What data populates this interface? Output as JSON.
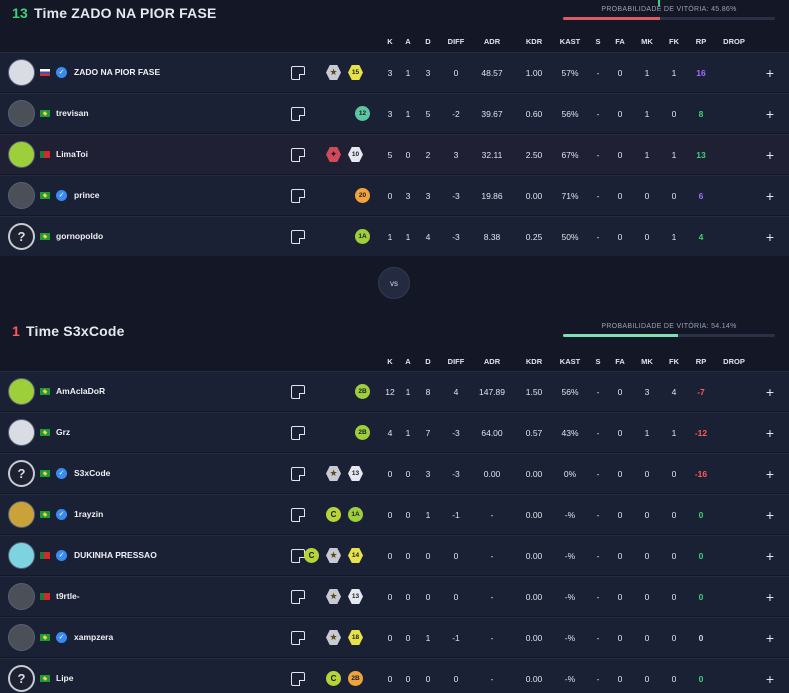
{
  "columns": [
    "K",
    "A",
    "D",
    "DIFF",
    "ADR",
    "KDR",
    "KAST",
    "S",
    "FA",
    "MK",
    "FK",
    "RP",
    "DROP"
  ],
  "vs_label": "vs",
  "teams": [
    {
      "score": "13",
      "score_color": "#3ad27a",
      "name": "Time ZADO NA PIOR FASE",
      "prob_label": "PROBABILIDADE DE VITÓRIA: 45.86%",
      "prob_fraction": 0.4586,
      "prob_color": "#e05a63",
      "players": [
        {
          "name": "ZADO NA PIOR FASE",
          "flag": "ru",
          "verified": true,
          "avatar": "white",
          "badges": [
            {
              "k": "star",
              "t": "★"
            },
            {
              "k": "level",
              "t": "15"
            }
          ],
          "stats": [
            "3",
            "1",
            "3",
            "0",
            "48.57",
            "1.00",
            "57%",
            "-",
            "0",
            "1",
            "1",
            "16"
          ],
          "rp_color": "purple"
        },
        {
          "name": "trevisan",
          "flag": "br",
          "verified": false,
          "avatar": "dark",
          "badges": [
            {
              "k": "circle-t",
              "t": "12"
            }
          ],
          "stats": [
            "3",
            "1",
            "5",
            "-2",
            "39.67",
            "0.60",
            "56%",
            "-",
            "0",
            "1",
            "0",
            "8"
          ],
          "rp_color": "green"
        },
        {
          "name": "LimaToi",
          "flag": "pt",
          "verified": false,
          "avatar": "lime",
          "badges": [
            {
              "k": "star red",
              "t": "✦"
            },
            {
              "k": "level w",
              "t": "10"
            }
          ],
          "stats": [
            "5",
            "0",
            "2",
            "3",
            "32.11",
            "2.50",
            "67%",
            "-",
            "0",
            "1",
            "1",
            "13"
          ],
          "rp_color": "green",
          "highlight": true
        },
        {
          "name": "prince",
          "flag": "br",
          "verified": true,
          "avatar": "dark",
          "badges": [
            {
              "k": "circle-o",
              "t": "20"
            }
          ],
          "stats": [
            "0",
            "3",
            "3",
            "-3",
            "19.86",
            "0.00",
            "71%",
            "-",
            "0",
            "0",
            "0",
            "6"
          ],
          "rp_color": "purple"
        },
        {
          "name": "gornopoldo",
          "flag": "br",
          "verified": false,
          "avatar": "q",
          "badges": [
            {
              "k": "circle-g",
              "t": "1A"
            }
          ],
          "stats": [
            "1",
            "1",
            "4",
            "-3",
            "8.38",
            "0.25",
            "50%",
            "-",
            "0",
            "0",
            "1",
            "4"
          ],
          "rp_color": "green"
        }
      ]
    },
    {
      "score": "1",
      "score_color": "#ff5a5a",
      "name": "Time S3xCode",
      "prob_label": "PROBABILIDADE DE VITÓRIA: 54.14%",
      "prob_fraction": 0.5414,
      "prob_color": "#7ee0b0",
      "players": [
        {
          "name": "AmAclaDoR",
          "flag": "br",
          "verified": false,
          "avatar": "lime",
          "badges": [
            {
              "k": "circle-g",
              "t": "2B"
            }
          ],
          "stats": [
            "12",
            "1",
            "8",
            "4",
            "147.89",
            "1.50",
            "56%",
            "-",
            "0",
            "3",
            "4",
            "-7"
          ],
          "rp_color": "red"
        },
        {
          "name": "Grz",
          "flag": "br",
          "verified": false,
          "avatar": "white",
          "badges": [
            {
              "k": "circle-g",
              "t": "2B"
            }
          ],
          "stats": [
            "4",
            "1",
            "7",
            "-3",
            "64.00",
            "0.57",
            "43%",
            "-",
            "0",
            "1",
            "1",
            "-12"
          ],
          "rp_color": "red"
        },
        {
          "name": "S3xCode",
          "flag": "br",
          "verified": true,
          "avatar": "q",
          "badges": [
            {
              "k": "star",
              "t": "★"
            },
            {
              "k": "level w",
              "t": "13"
            }
          ],
          "stats": [
            "0",
            "0",
            "3",
            "-3",
            "0.00",
            "0.00",
            "0%",
            "-",
            "0",
            "0",
            "0",
            "-16"
          ],
          "rp_color": "red"
        },
        {
          "name": "1rayzin",
          "flag": "br",
          "verified": true,
          "avatar": "gold",
          "badges": [
            {
              "k": "c",
              "t": "C"
            },
            {
              "k": "circle-g",
              "t": "1A"
            }
          ],
          "stats": [
            "0",
            "0",
            "1",
            "-1",
            "-",
            "0.00",
            "-%",
            "-",
            "0",
            "0",
            "0",
            "0"
          ],
          "rp_color": "green"
        },
        {
          "name": "DUKINHA PRESSAO",
          "flag": "pt",
          "verified": true,
          "avatar": "cyan",
          "badges": [
            {
              "k": "c",
              "t": "C"
            },
            {
              "k": "star",
              "t": "★"
            },
            {
              "k": "level",
              "t": "14"
            }
          ],
          "stats": [
            "0",
            "0",
            "0",
            "0",
            "-",
            "0.00",
            "-%",
            "-",
            "0",
            "0",
            "0",
            "0"
          ],
          "rp_color": "green"
        },
        {
          "name": "t9rtle-",
          "flag": "pt",
          "verified": false,
          "avatar": "dark",
          "badges": [
            {
              "k": "star",
              "t": "★"
            },
            {
              "k": "level w",
              "t": "13"
            }
          ],
          "stats": [
            "0",
            "0",
            "0",
            "0",
            "-",
            "0.00",
            "-%",
            "-",
            "0",
            "0",
            "0",
            "0"
          ],
          "rp_color": "green"
        },
        {
          "name": "xampzera",
          "flag": "br",
          "verified": true,
          "avatar": "dark",
          "badges": [
            {
              "k": "star",
              "t": "★"
            },
            {
              "k": "level",
              "t": "18"
            }
          ],
          "stats": [
            "0",
            "0",
            "1",
            "-1",
            "-",
            "0.00",
            "-%",
            "-",
            "0",
            "0",
            "0",
            "0"
          ],
          "rp_color": "gray"
        },
        {
          "name": "Lipe",
          "flag": "br",
          "verified": false,
          "avatar": "q",
          "badges": [
            {
              "k": "c",
              "t": "C"
            },
            {
              "k": "circle-o",
              "t": "2B"
            }
          ],
          "stats": [
            "0",
            "0",
            "0",
            "0",
            "-",
            "0.00",
            "-%",
            "-",
            "0",
            "0",
            "0",
            "0"
          ],
          "rp_color": "green"
        }
      ]
    }
  ]
}
